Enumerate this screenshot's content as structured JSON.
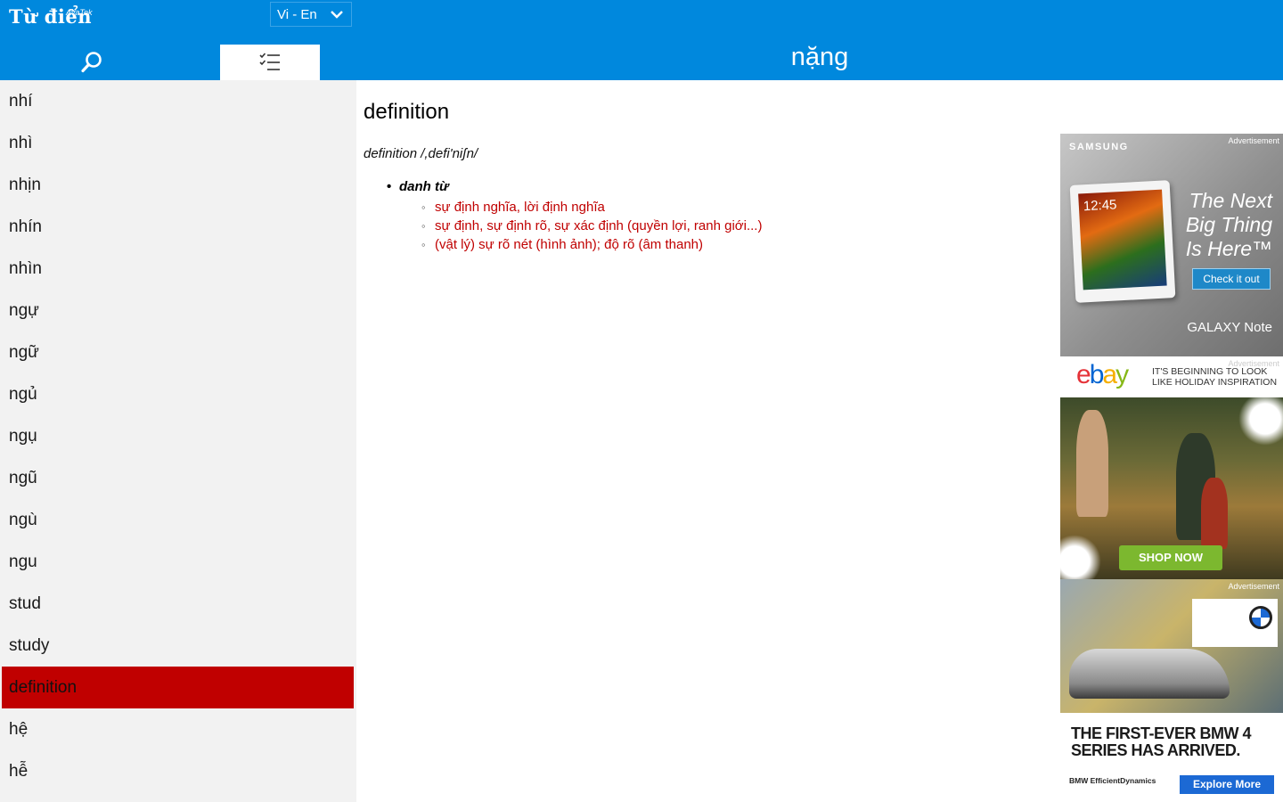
{
  "app": {
    "logo_text": "Từ điển",
    "brand": "AvaTek",
    "language_pair": "Vi - En"
  },
  "topbar": {
    "title": "nặng"
  },
  "word_list": [
    "nhí",
    "nhì",
    "nhịn",
    "nhín",
    "nhìn",
    "ngự",
    "ngữ",
    "ngủ",
    "ngụ",
    "ngũ",
    "ngù",
    "ngu",
    "stud",
    "study",
    "definition",
    "hệ",
    "hễ"
  ],
  "selected_word": "definition",
  "entry": {
    "headword": "definition",
    "pronunciation": "definition /,defi'niʃn/",
    "part_of_speech": "danh từ",
    "senses": [
      "sự định nghĩa, lời định nghĩa",
      "sự định, sự định rõ, sự xác định (quyền lợi, ranh giới...)",
      "(vật lý) sự rõ nét (hình ảnh); độ rõ (âm thanh)"
    ]
  },
  "ads": {
    "label": "Advertisement",
    "samsung": {
      "brand": "SAMSUNG",
      "clock": "12:45",
      "headline_1": "The Next",
      "headline_2": "Big Thing",
      "headline_3": "Is Here™",
      "cta": "Check it out",
      "model": "GALAXY Note"
    },
    "ebay": {
      "tagline": "IT'S BEGINNING TO LOOK LIKE HOLIDAY INSPIRATION",
      "cta": "SHOP NOW"
    },
    "bmw": {
      "headline": "THE FIRST-EVER BMW 4 SERIES HAS ARRIVED.",
      "tagline": "BMW EfficientDynamics",
      "cta": "Explore More"
    }
  },
  "colors": {
    "header_blue": "#0088dd",
    "selected_red": "#c00000",
    "sense_red": "#c00000"
  }
}
